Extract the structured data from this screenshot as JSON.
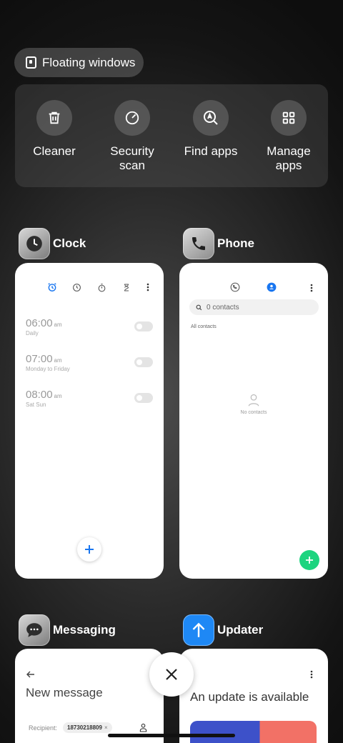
{
  "floating_windows": {
    "label": "Floating windows"
  },
  "tools": [
    {
      "label": "Cleaner",
      "icon": "trash-icon"
    },
    {
      "label": "Security scan",
      "icon": "shield-scan-icon"
    },
    {
      "label": "Find apps",
      "icon": "search-app-icon"
    },
    {
      "label": "Manage apps",
      "icon": "grid-icon"
    }
  ],
  "apps": {
    "clock": {
      "name": "Clock",
      "alarms": [
        {
          "time": "06:00",
          "ampm": "am",
          "repeat": "Daily"
        },
        {
          "time": "07:00",
          "ampm": "am",
          "repeat": "Monday to Friday"
        },
        {
          "time": "08:00",
          "ampm": "am",
          "repeat": "Sat Sun"
        }
      ]
    },
    "phone": {
      "name": "Phone",
      "search_placeholder": "0 contacts",
      "all_contacts": "All contacts",
      "empty_text": "No contacts"
    },
    "messaging": {
      "name": "Messaging",
      "title": "New message",
      "recipient_label": "Recipient:",
      "recipient_number": "18730218809",
      "chip_close": "×"
    },
    "updater": {
      "name": "Updater",
      "title": "An update is available"
    }
  },
  "colors": {
    "accent_blue": "#1976f0",
    "fab_green": "#1dd47f",
    "updater_blue": "#1e88f5"
  }
}
